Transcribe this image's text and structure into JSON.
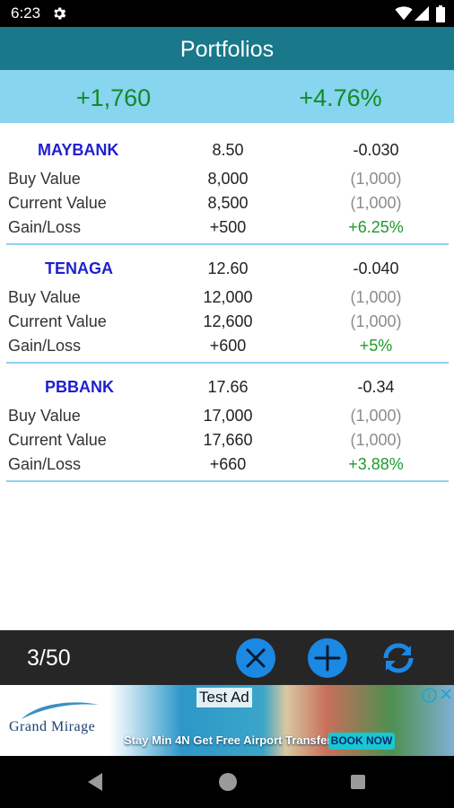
{
  "status_bar": {
    "time": "6:23",
    "icons": [
      "gear-icon",
      "wifi-icon",
      "signal-icon",
      "battery-icon"
    ]
  },
  "app_bar": {
    "title": "Portfolios"
  },
  "summary": {
    "total_gain": "+1,760",
    "total_gain_pct": "+4.76%"
  },
  "labels": {
    "buy_value": "Buy Value",
    "current_value": "Current Value",
    "gain_loss": "Gain/Loss"
  },
  "portfolios": [
    {
      "name": "MAYBANK",
      "price": "8.50",
      "change": "-0.030",
      "buy_value": "8,000",
      "buy_qty": "(1,000)",
      "current_value": "8,500",
      "current_qty": "(1,000)",
      "gain": "+500",
      "gain_pct": "+6.25%"
    },
    {
      "name": "TENAGA",
      "price": "12.60",
      "change": "-0.040",
      "buy_value": "12,000",
      "buy_qty": "(1,000)",
      "current_value": "12,600",
      "current_qty": "(1,000)",
      "gain": "+600",
      "gain_pct": "+5%"
    },
    {
      "name": "PBBANK",
      "price": "17.66",
      "change": "-0.34",
      "buy_value": "17,000",
      "buy_qty": "(1,000)",
      "current_value": "17,660",
      "current_qty": "(1,000)",
      "gain": "+660",
      "gain_pct": "+3.88%"
    }
  ],
  "toolbar": {
    "counter": "3/50",
    "buttons": [
      "close-icon",
      "plus-icon",
      "refresh-icon"
    ]
  },
  "ad": {
    "label": "Test Ad",
    "brand": "Grand Mirage",
    "tagline": "Stay Min 4N Get Free Airport Transfer",
    "cta": "BOOK NOW"
  },
  "nav": {
    "icons": [
      "back-icon",
      "home-icon",
      "recents-icon"
    ]
  },
  "colors": {
    "app_bar": "#19788a",
    "summary_bg": "#87d5ee",
    "gain_green": "#1f9a2f",
    "stock_name": "#1f1fd0",
    "toolbar_bg": "#262626",
    "button_blue": "#1b88e4"
  }
}
